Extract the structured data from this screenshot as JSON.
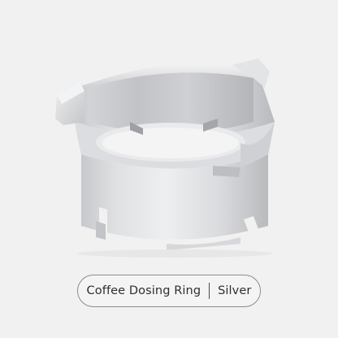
{
  "caption": {
    "product_name": "Coffee Dosing Ring",
    "color_variant": "Silver"
  },
  "colors": {
    "background": "#f1f1f1",
    "metal_light": "#e6e7e9",
    "metal_mid": "#c9cacd",
    "metal_dark": "#a7a8ac",
    "pill_border": "#8c8c8c",
    "text": "#2f2f2f"
  }
}
